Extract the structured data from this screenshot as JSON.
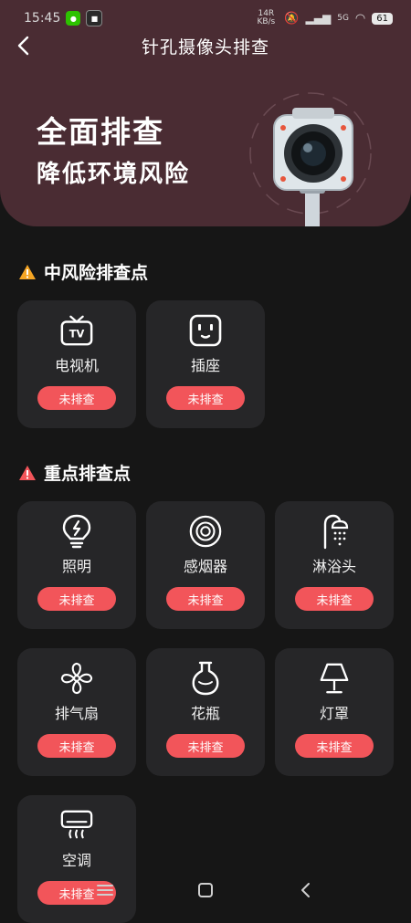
{
  "status_bar": {
    "time": "15:45",
    "net_speed": "14R KB/s",
    "network": "5G",
    "battery": "61"
  },
  "nav": {
    "title": "针孔摄像头排查"
  },
  "hero": {
    "title": "全面排查",
    "subtitle": "降低环境风险"
  },
  "sections": [
    {
      "title": "中风险排查点",
      "items": [
        {
          "label": "电视机",
          "icon": "tv-icon",
          "status": "未排查"
        },
        {
          "label": "插座",
          "icon": "socket-icon",
          "status": "未排查"
        }
      ]
    },
    {
      "title": "重点排查点",
      "items": [
        {
          "label": "照明",
          "icon": "lightbulb-icon",
          "status": "未排查"
        },
        {
          "label": "感烟器",
          "icon": "smoke-detector-icon",
          "status": "未排查"
        },
        {
          "label": "淋浴头",
          "icon": "shower-icon",
          "status": "未排查"
        },
        {
          "label": "排气扇",
          "icon": "fan-icon",
          "status": "未排查"
        },
        {
          "label": "花瓶",
          "icon": "vase-icon",
          "status": "未排查"
        },
        {
          "label": "灯罩",
          "icon": "lampshade-icon",
          "status": "未排查"
        },
        {
          "label": "空调",
          "icon": "air-conditioner-icon",
          "status": "未排查"
        }
      ]
    }
  ],
  "colors": {
    "hero_bg": "#4a2c33",
    "page_bg": "#161616",
    "card_bg": "#262628",
    "status_button": "#f2555a",
    "warning_orange": "#f5a524",
    "warning_red": "#f2555a"
  }
}
